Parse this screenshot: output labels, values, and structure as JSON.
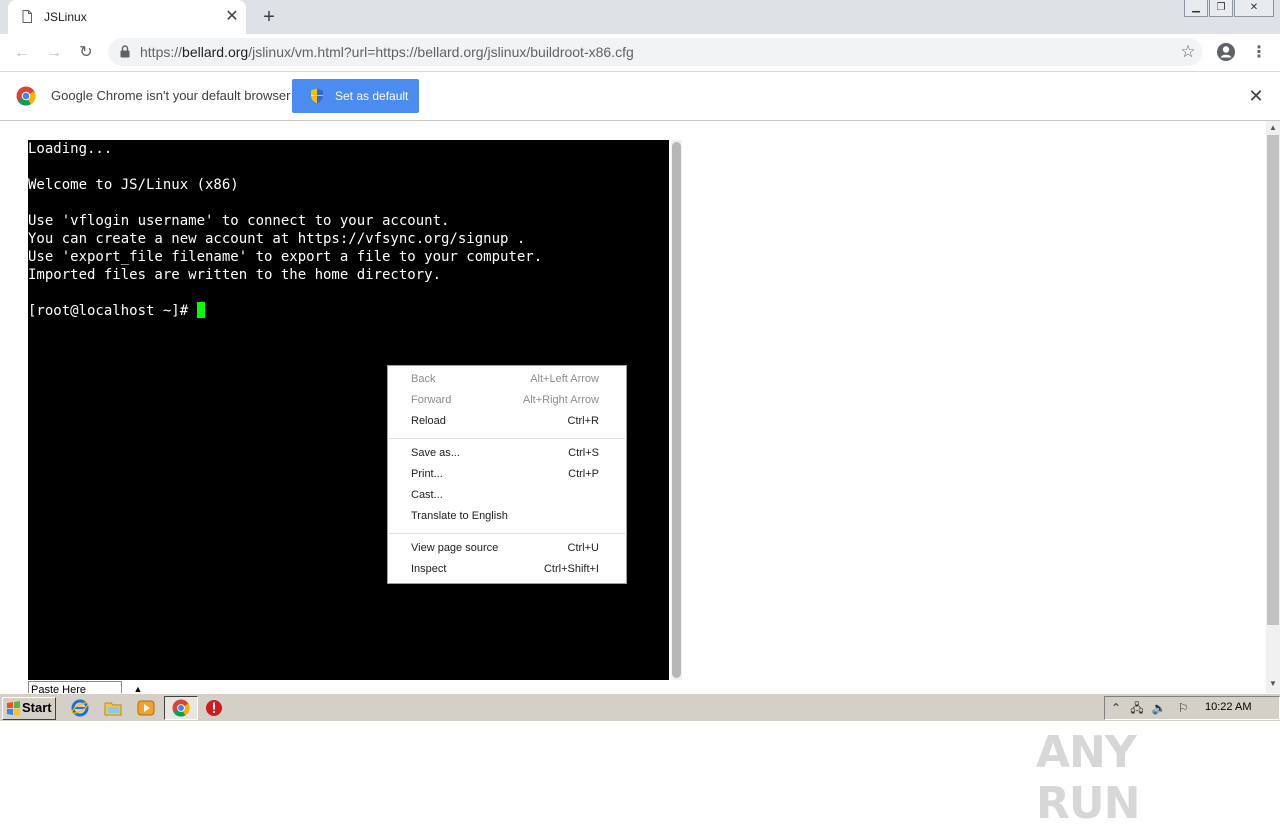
{
  "browser": {
    "tab_title": "JSLinux",
    "url_prefix": "https://",
    "url_domain": "bellard.org",
    "url_path": "/jslinux/vm.html?url=https://bellard.org/jslinux/buildroot-x86.cfg",
    "new_tab_glyph": "+",
    "close_glyph": "✕"
  },
  "infobar": {
    "message": "Google Chrome isn't your default browser",
    "button_label": "Set as default"
  },
  "terminal": {
    "lines": [
      "Loading...",
      "",
      "Welcome to JS/Linux (x86)",
      "",
      "Use 'vflogin username' to connect to your account.",
      "You can create a new account at https://vfsync.org/signup .",
      "Use 'export_file filename' to export a file to your computer.",
      "Imported files are written to the home directory.",
      ""
    ],
    "prompt": "[root@localhost ~]# ",
    "cursor_color": "#00ff00",
    "paste_label": "Paste Here"
  },
  "context_menu": {
    "items": [
      {
        "label": "Back",
        "shortcut": "Alt+Left Arrow",
        "disabled": true
      },
      {
        "label": "Forward",
        "shortcut": "Alt+Right Arrow",
        "disabled": true
      },
      {
        "label": "Reload",
        "shortcut": "Ctrl+R",
        "disabled": false
      },
      {
        "label": "Save as...",
        "shortcut": "Ctrl+S",
        "disabled": false
      },
      {
        "label": "Print...",
        "shortcut": "Ctrl+P",
        "disabled": false
      },
      {
        "label": "Cast...",
        "shortcut": "",
        "disabled": false
      },
      {
        "label": "Translate to English",
        "shortcut": "",
        "disabled": false
      },
      {
        "label": "View page source",
        "shortcut": "Ctrl+U",
        "disabled": false
      },
      {
        "label": "Inspect",
        "shortcut": "Ctrl+Shift+I",
        "disabled": false
      }
    ]
  },
  "watermark": {
    "text": "ANY RUN"
  },
  "taskbar": {
    "start_label": "Start",
    "clock": "10:22 AM",
    "pinned_icons": [
      "ie-icon",
      "folder-icon",
      "media-player-icon",
      "chrome-icon",
      "security-alert-icon"
    ]
  },
  "colors": {
    "accent": "#4a8cf0",
    "terminal_bg": "#000000",
    "tab_strip": "#dee1e6"
  }
}
